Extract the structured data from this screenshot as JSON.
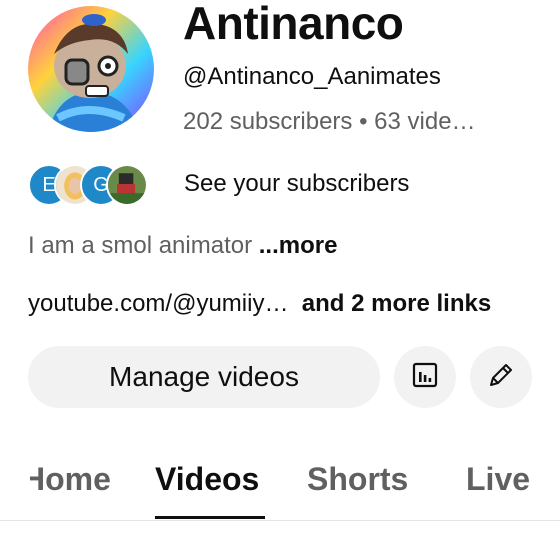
{
  "channel": {
    "name": "Antinanco",
    "handle": "@Antinanco_Aanimates",
    "stats": "202 subscribers • 63 vide…"
  },
  "subscribers_preview": {
    "avatars": [
      {
        "letter": "E",
        "color": "#1e88c9"
      },
      {
        "letter": "",
        "color": "#f2c15b"
      },
      {
        "letter": "G",
        "color": "#1e88c9"
      },
      {
        "letter": "",
        "color": "#3a6b2a"
      }
    ],
    "label": "See your subscribers"
  },
  "description": {
    "text": "I am a smol animator ",
    "more_label": "...more"
  },
  "links": {
    "primary": "youtube.com/@yumiiy…",
    "extra": "and 2 more links"
  },
  "actions": {
    "manage_label": "Manage videos",
    "analytics_icon": "analytics-icon",
    "edit_icon": "pencil-icon"
  },
  "tabs": [
    {
      "label": "Home",
      "active": false
    },
    {
      "label": "Videos",
      "active": true
    },
    {
      "label": "Shorts",
      "active": false
    },
    {
      "label": "Live",
      "active": false
    }
  ],
  "colors": {
    "primary_text": "#0f0f0f",
    "secondary_text": "#606060",
    "button_bg": "#f2f2f2",
    "accent_blue": "#1e88c9"
  }
}
